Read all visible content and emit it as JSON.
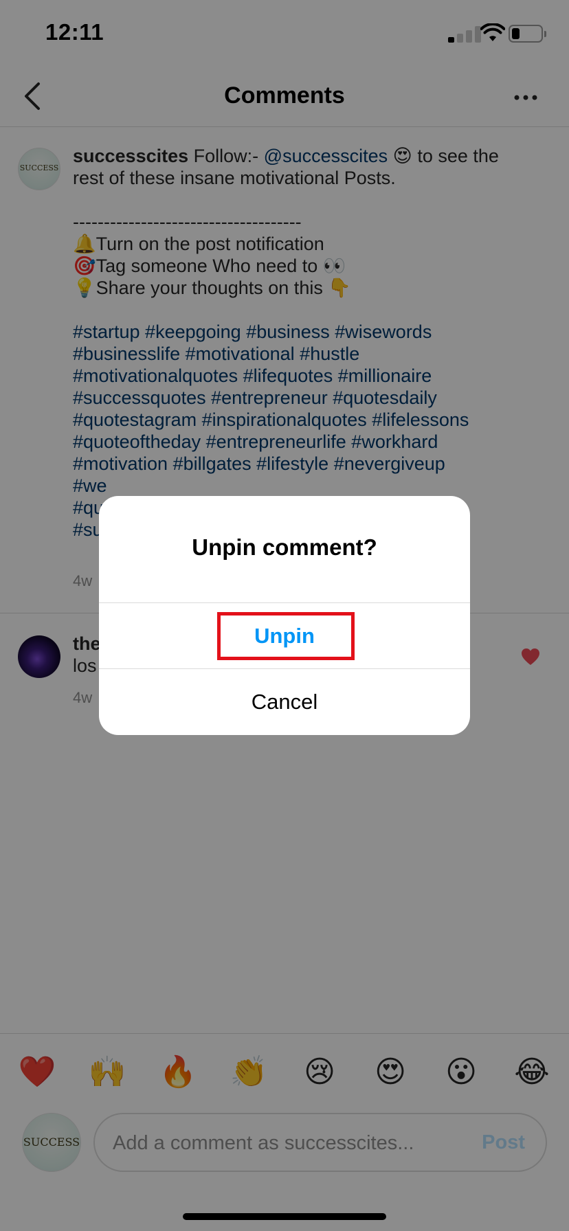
{
  "status_bar": {
    "time": "12:11",
    "battery_level": 0.3
  },
  "header": {
    "title": "Comments",
    "back_icon": "chevron-left-icon",
    "more_icon": "more-horizontal-icon"
  },
  "caption": {
    "username": "successcites",
    "avatar_text": "SUCCESS",
    "line1_text": " Follow:- ",
    "mention": "@successcites",
    "line1_emoji": "😍",
    "line1_rest": " to see the",
    "line2": "rest of these insane motivational Posts.",
    "divider_line": "-------------------------------------",
    "line_bell": "🔔Turn on the post notification",
    "line_target": "🎯Tag someone Who need to 👀",
    "line_bulb": "💡Share your thoughts on this  👇",
    "hashtags": [
      "#startup #keepgoing #business #wisewords",
      "#businesslife #motivational #hustle",
      "#motivationalquotes #lifequotes #millionaire",
      "#successquotes #entrepreneur #quotesdaily",
      "#quotestagram #inspirationalquotes #lifelessons",
      "#quoteoftheday #entrepreneurlife #workhard",
      "#motivation #billgates #lifestyle #nevergiveup",
      "#we",
      "#qu                                                            dset",
      "#su"
    ],
    "time": "4w"
  },
  "comment": {
    "username": "the",
    "text": "los",
    "time": "4w",
    "like_icon": "heart-filled-icon",
    "like_color": "#ed4956"
  },
  "emoji_bar": {
    "items": [
      "❤️",
      "🙌",
      "🔥",
      "👏",
      "😢",
      "😍",
      "😮",
      "😂"
    ]
  },
  "composer": {
    "avatar_text": "SUCCESS",
    "placeholder": "Add a comment as successcites...",
    "post_label": "Post"
  },
  "dialog": {
    "title": "Unpin comment?",
    "unpin_label": "Unpin",
    "cancel_label": "Cancel",
    "unpin_color": "#0095f6",
    "highlight_color": "#e3111a"
  }
}
